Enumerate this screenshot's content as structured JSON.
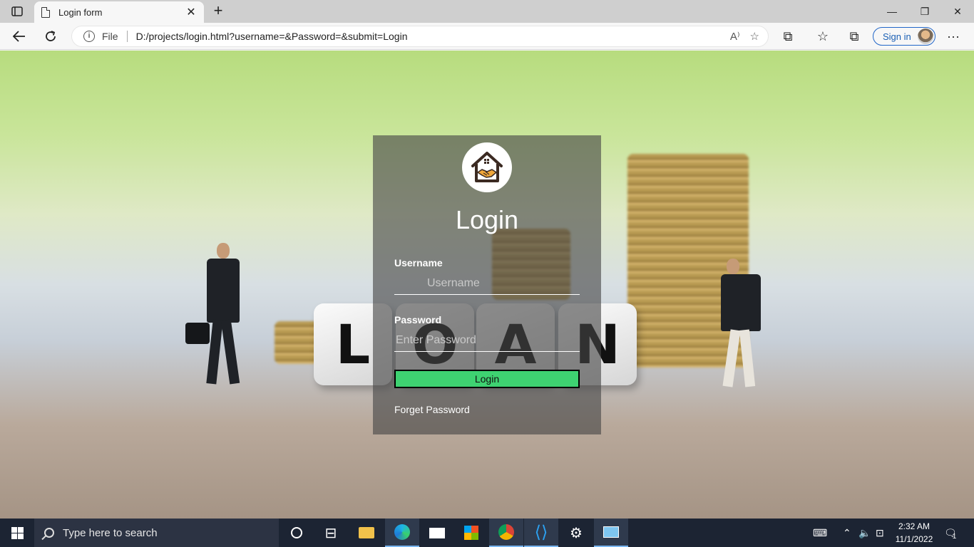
{
  "browser": {
    "tab_title": "Login form",
    "close_tab": "✕",
    "new_tab": "+",
    "address": {
      "file_label": "File",
      "url": "D:/projects/login.html?username=&Password=&submit=Login"
    },
    "sign_in_label": "Sign in",
    "window_controls": {
      "minimize": "—",
      "restore": "❐",
      "close": "✕"
    },
    "menu": "···"
  },
  "login_form": {
    "title": "Login",
    "username_label": "Username",
    "username_placeholder": "Username",
    "username_value": "",
    "password_label": "Password",
    "password_placeholder": "Enter Password",
    "password_value": "",
    "submit_label": "Login",
    "forget_password_label": "Forget Password"
  },
  "background": {
    "dice_letters": [
      "L",
      "O",
      "A",
      "N"
    ]
  },
  "taskbar": {
    "search_placeholder": "Type here to search",
    "time": "2:32 AM",
    "date": "11/1/2022",
    "notification_count": "1"
  },
  "colors": {
    "login_button": "#3ed271",
    "card_overlay": "rgba(70,70,70,0.62)",
    "taskbar": "#1c2433",
    "sign_in_accent": "#2166c8"
  }
}
